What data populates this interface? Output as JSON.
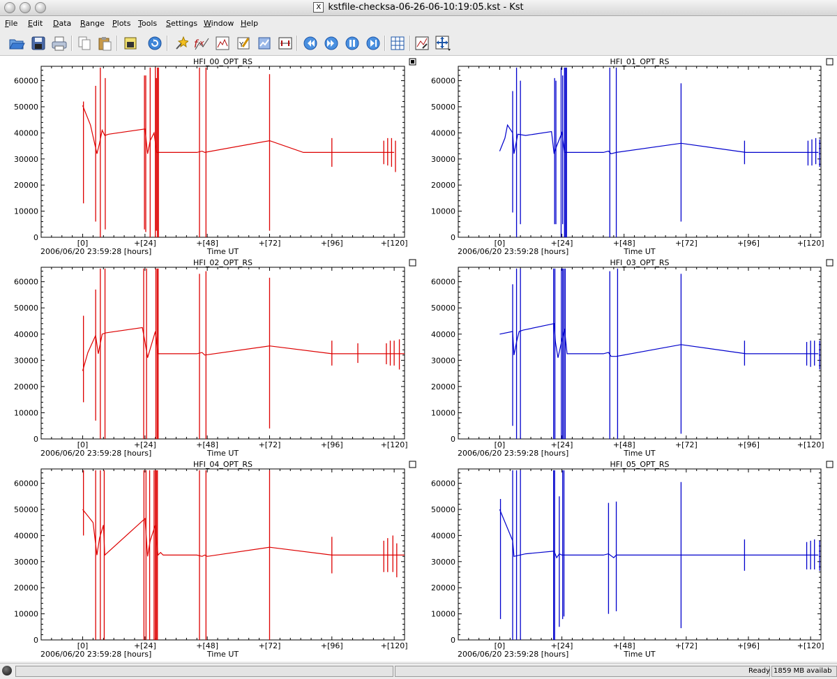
{
  "window": {
    "title": "kstfile-checksa-06-26-06-10:19:05.kst - Kst",
    "x_logo": "X"
  },
  "menu": [
    {
      "mnemonic": "F",
      "rest": "ile"
    },
    {
      "mnemonic": "E",
      "rest": "dit"
    },
    {
      "mnemonic": "D",
      "rest": "ata"
    },
    {
      "mnemonic": "R",
      "rest": "ange"
    },
    {
      "mnemonic": "P",
      "rest": "lots"
    },
    {
      "mnemonic": "T",
      "rest": "ools"
    },
    {
      "mnemonic": "S",
      "rest": "ettings"
    },
    {
      "mnemonic": "W",
      "rest": "indow"
    },
    {
      "mnemonic": "H",
      "rest": "elp"
    }
  ],
  "toolbar_icons": [
    "open-icon",
    "save-icon",
    "print-icon",
    "copy-icon",
    "paste-icon",
    "export-icon",
    "reload-icon",
    "data-wizard-icon",
    "equation-icon",
    "histogram-icon",
    "plugin-icon",
    "power-spectrum-icon",
    "event-monitor-icon",
    "back-icon",
    "forward-icon",
    "pause-icon",
    "end-icon",
    "layout-mode-icon",
    "zoom-mode-icon",
    "xy-zoom-icon"
  ],
  "status": {
    "ready": "Ready",
    "memory": "1859 MB availab"
  },
  "colors": {
    "red": "#dd0000",
    "blue": "#0000cc"
  },
  "plots": [
    {
      "title": "HFI_00_OPT_RS",
      "color": "red",
      "selected": true,
      "base": [
        [
          0,
          50500
        ],
        [
          3,
          43000
        ],
        [
          5.5,
          32000
        ],
        [
          6.5,
          36000
        ],
        [
          7.5,
          41000
        ],
        [
          8.5,
          39000
        ],
        [
          10,
          39500
        ],
        [
          24,
          41500
        ],
        [
          25,
          32000
        ],
        [
          26,
          37000
        ],
        [
          27.5,
          40000
        ],
        [
          28.5,
          32500
        ],
        [
          30,
          32500
        ],
        [
          44,
          32500
        ],
        [
          46,
          33000
        ],
        [
          47,
          32500
        ],
        [
          72,
          37000
        ],
        [
          85,
          32500
        ],
        [
          120,
          32500
        ]
      ],
      "spikes": [
        [
          0.3,
          13000,
          52000
        ],
        [
          5,
          6000,
          58000
        ],
        [
          6.8,
          0,
          65000
        ],
        [
          8.7,
          3000,
          61000
        ],
        [
          23.8,
          3000,
          62000
        ],
        [
          24.3,
          2000,
          62000
        ],
        [
          26,
          0,
          65000
        ],
        [
          28,
          0,
          65000
        ],
        [
          28.4,
          2500,
          61000
        ],
        [
          28.8,
          0,
          65000
        ],
        [
          29.2,
          0,
          65000
        ],
        [
          45,
          0,
          65000
        ],
        [
          47.5,
          0,
          65000
        ],
        [
          72,
          2500,
          62500
        ],
        [
          96,
          27000,
          38000
        ],
        [
          116,
          28000,
          37000
        ],
        [
          117.5,
          27500,
          38000
        ],
        [
          119,
          27000,
          38000
        ],
        [
          120.5,
          25000,
          37000
        ]
      ]
    },
    {
      "title": "HFI_01_OPT_RS",
      "color": "blue",
      "selected": false,
      "base": [
        [
          0,
          33000
        ],
        [
          2,
          38000
        ],
        [
          3,
          43000
        ],
        [
          5,
          40000
        ],
        [
          5.5,
          32000
        ],
        [
          7,
          39500
        ],
        [
          10,
          39000
        ],
        [
          20,
          40500
        ],
        [
          21,
          32000
        ],
        [
          22,
          35000
        ],
        [
          24,
          40000
        ],
        [
          25,
          32500
        ],
        [
          30,
          32500
        ],
        [
          40,
          32500
        ],
        [
          42,
          33000
        ],
        [
          43,
          32000
        ],
        [
          45,
          32500
        ],
        [
          70,
          36000
        ],
        [
          95,
          32500
        ],
        [
          123,
          32500
        ]
      ],
      "spikes": [
        [
          5,
          9500,
          56000
        ],
        [
          6.5,
          0,
          65000
        ],
        [
          8,
          5000,
          60000
        ],
        [
          21.2,
          5000,
          61000
        ],
        [
          21.7,
          5000,
          60000
        ],
        [
          23.7,
          0,
          65000
        ],
        [
          24.3,
          5000,
          62000
        ],
        [
          25,
          0,
          65000
        ],
        [
          25.4,
          0,
          65000
        ],
        [
          25.8,
          0,
          65000
        ],
        [
          42.5,
          0,
          65000
        ],
        [
          45,
          0,
          65000
        ],
        [
          70,
          6000,
          59000
        ],
        [
          94.5,
          28000,
          37000
        ],
        [
          119,
          27500,
          37000
        ],
        [
          120.5,
          27500,
          37500
        ],
        [
          122,
          28000,
          38000
        ],
        [
          123.5,
          27000,
          37500
        ]
      ]
    },
    {
      "title": "HFI_02_OPT_RS",
      "color": "red",
      "selected": false,
      "base": [
        [
          0,
          26000
        ],
        [
          2,
          33000
        ],
        [
          5,
          39500
        ],
        [
          6,
          32500
        ],
        [
          7.5,
          40000
        ],
        [
          9,
          40500
        ],
        [
          23,
          42500
        ],
        [
          24,
          37000
        ],
        [
          25,
          31000
        ],
        [
          28,
          41000
        ],
        [
          29,
          32500
        ],
        [
          30,
          32500
        ],
        [
          44,
          32500
        ],
        [
          46,
          33000
        ],
        [
          47,
          32000
        ],
        [
          72,
          35500
        ],
        [
          96,
          32500
        ],
        [
          130,
          32500
        ]
      ],
      "spikes": [
        [
          0.3,
          14000,
          47000
        ],
        [
          5,
          7000,
          57000
        ],
        [
          6.8,
          0,
          65000
        ],
        [
          8.6,
          0,
          65000
        ],
        [
          23.5,
          0,
          65000
        ],
        [
          24.6,
          0,
          65000
        ],
        [
          28.2,
          0,
          65000
        ],
        [
          28.7,
          0,
          65000
        ],
        [
          29.1,
          0,
          65000
        ],
        [
          45,
          0,
          63000
        ],
        [
          47.5,
          0,
          64000
        ],
        [
          72,
          4000,
          61500
        ],
        [
          96,
          28000,
          37500
        ],
        [
          106,
          29000,
          36500
        ],
        [
          117,
          28500,
          36500
        ],
        [
          118.5,
          28000,
          37500
        ],
        [
          120,
          28000,
          37500
        ],
        [
          122,
          26500,
          38000
        ]
      ]
    },
    {
      "title": "HFI_03_OPT_RS",
      "color": "blue",
      "selected": false,
      "base": [
        [
          0,
          40000
        ],
        [
          5,
          41000
        ],
        [
          5.5,
          32000
        ],
        [
          6.5,
          37000
        ],
        [
          7.5,
          41000
        ],
        [
          9,
          41500
        ],
        [
          21,
          44000
        ],
        [
          21.5,
          37000
        ],
        [
          22.5,
          31000
        ],
        [
          25,
          42000
        ],
        [
          26,
          32500
        ],
        [
          30,
          32500
        ],
        [
          40,
          32500
        ],
        [
          42,
          33000
        ],
        [
          43,
          31500
        ],
        [
          45,
          31500
        ],
        [
          70,
          36000
        ],
        [
          95,
          32500
        ],
        [
          123,
          32500
        ]
      ],
      "spikes": [
        [
          5,
          5000,
          59000
        ],
        [
          6.5,
          0,
          65000
        ],
        [
          8,
          0,
          65000
        ],
        [
          20.8,
          0,
          65000
        ],
        [
          21.3,
          0,
          65000
        ],
        [
          23.8,
          0,
          65000
        ],
        [
          24.3,
          0,
          65000
        ],
        [
          24.8,
          0,
          65000
        ],
        [
          25.3,
          0,
          65000
        ],
        [
          42.5,
          0,
          64000
        ],
        [
          45.5,
          0,
          65000
        ],
        [
          70,
          2000,
          63000
        ],
        [
          94.5,
          28000,
          37500
        ],
        [
          118.5,
          28000,
          37000
        ],
        [
          120,
          27500,
          37500
        ],
        [
          121.5,
          28000,
          37500
        ],
        [
          123.5,
          26500,
          37500
        ]
      ]
    },
    {
      "title": "HFI_04_OPT_RS",
      "color": "red",
      "selected": false,
      "base": [
        [
          0,
          50000
        ],
        [
          4,
          45000
        ],
        [
          5.5,
          32500
        ],
        [
          6.5,
          39000
        ],
        [
          8,
          44000
        ],
        [
          8.5,
          32500
        ],
        [
          24,
          46500
        ],
        [
          25,
          32000
        ],
        [
          26,
          38000
        ],
        [
          28,
          44000
        ],
        [
          29,
          32500
        ],
        [
          30,
          33500
        ],
        [
          31,
          32500
        ],
        [
          44,
          32500
        ],
        [
          46,
          32000
        ],
        [
          47,
          32500
        ],
        [
          48,
          32000
        ],
        [
          72,
          35500
        ],
        [
          96,
          32500
        ],
        [
          130,
          32500
        ]
      ],
      "spikes": [
        [
          0.3,
          40000,
          65000
        ],
        [
          5,
          0,
          65000
        ],
        [
          6.8,
          0,
          65000
        ],
        [
          8.3,
          0,
          65000
        ],
        [
          23.6,
          0,
          65000
        ],
        [
          24.4,
          0,
          65000
        ],
        [
          25.8,
          0,
          65000
        ],
        [
          27.5,
          0,
          65000
        ],
        [
          28,
          0,
          65000
        ],
        [
          28.4,
          0,
          65000
        ],
        [
          28.8,
          0,
          65000
        ],
        [
          45,
          0,
          65000
        ],
        [
          47.5,
          0,
          65000
        ],
        [
          72,
          0,
          65000
        ],
        [
          96,
          25500,
          39500
        ],
        [
          116,
          26000,
          38000
        ],
        [
          117.5,
          26000,
          39000
        ],
        [
          119.5,
          26000,
          40000
        ],
        [
          121,
          24000,
          37000
        ]
      ]
    },
    {
      "title": "HFI_05_OPT_RS",
      "color": "blue",
      "selected": false,
      "base": [
        [
          0,
          50000
        ],
        [
          5,
          38000
        ],
        [
          5.5,
          32000
        ],
        [
          10,
          33000
        ],
        [
          21,
          34000
        ],
        [
          22,
          31500
        ],
        [
          23,
          33000
        ],
        [
          24,
          32500
        ],
        [
          40,
          32500
        ],
        [
          42,
          33000
        ],
        [
          44,
          31500
        ],
        [
          45,
          32500
        ],
        [
          70,
          32500
        ],
        [
          95,
          32500
        ],
        [
          123,
          32500
        ]
      ],
      "spikes": [
        [
          0.3,
          8000,
          54000
        ],
        [
          5,
          0,
          65000
        ],
        [
          6.5,
          0,
          65000
        ],
        [
          8,
          0,
          65000
        ],
        [
          20.8,
          0,
          65000
        ],
        [
          21.2,
          0,
          65000
        ],
        [
          23,
          5000,
          55000
        ],
        [
          24.3,
          8000,
          65000
        ],
        [
          24.8,
          9000,
          65000
        ],
        [
          42,
          10000,
          52500
        ],
        [
          45,
          11000,
          53000
        ],
        [
          70,
          4500,
          60500
        ],
        [
          94.5,
          26500,
          38500
        ],
        [
          118.5,
          27000,
          37500
        ],
        [
          120,
          27000,
          38000
        ],
        [
          121.5,
          27000,
          38500
        ],
        [
          123.5,
          26500,
          38000
        ]
      ]
    }
  ],
  "axes": {
    "xlim": [
      -16,
      124
    ],
    "ylim": [
      0,
      65500
    ],
    "xticks": [
      0,
      24,
      48,
      72,
      96,
      120
    ],
    "xtick_labels": [
      "[0]",
      "+[24]",
      "+[48]",
      "+[72]",
      "+[96]",
      "+[120]"
    ],
    "yticks": [
      0,
      10000,
      20000,
      30000,
      40000,
      50000,
      60000
    ],
    "ytick_labels": [
      "0",
      "10000",
      "20000",
      "30000",
      "40000",
      "50000",
      "60000"
    ],
    "xlabel": "Time UT",
    "x_offset_label": "2006/06/20 23:59:28 [hours]"
  },
  "chart_data": {
    "type": "line",
    "x_unit": "hours since 2006/06/20 23:59:28",
    "xlabel": "Time UT",
    "xlim": [
      -16,
      124
    ],
    "ylim": [
      0,
      65500
    ],
    "grid": false,
    "panels": [
      "HFI_00_OPT_RS",
      "HFI_01_OPT_RS",
      "HFI_02_OPT_RS",
      "HFI_03_OPT_RS",
      "HFI_04_OPT_RS",
      "HFI_05_OPT_RS"
    ]
  }
}
